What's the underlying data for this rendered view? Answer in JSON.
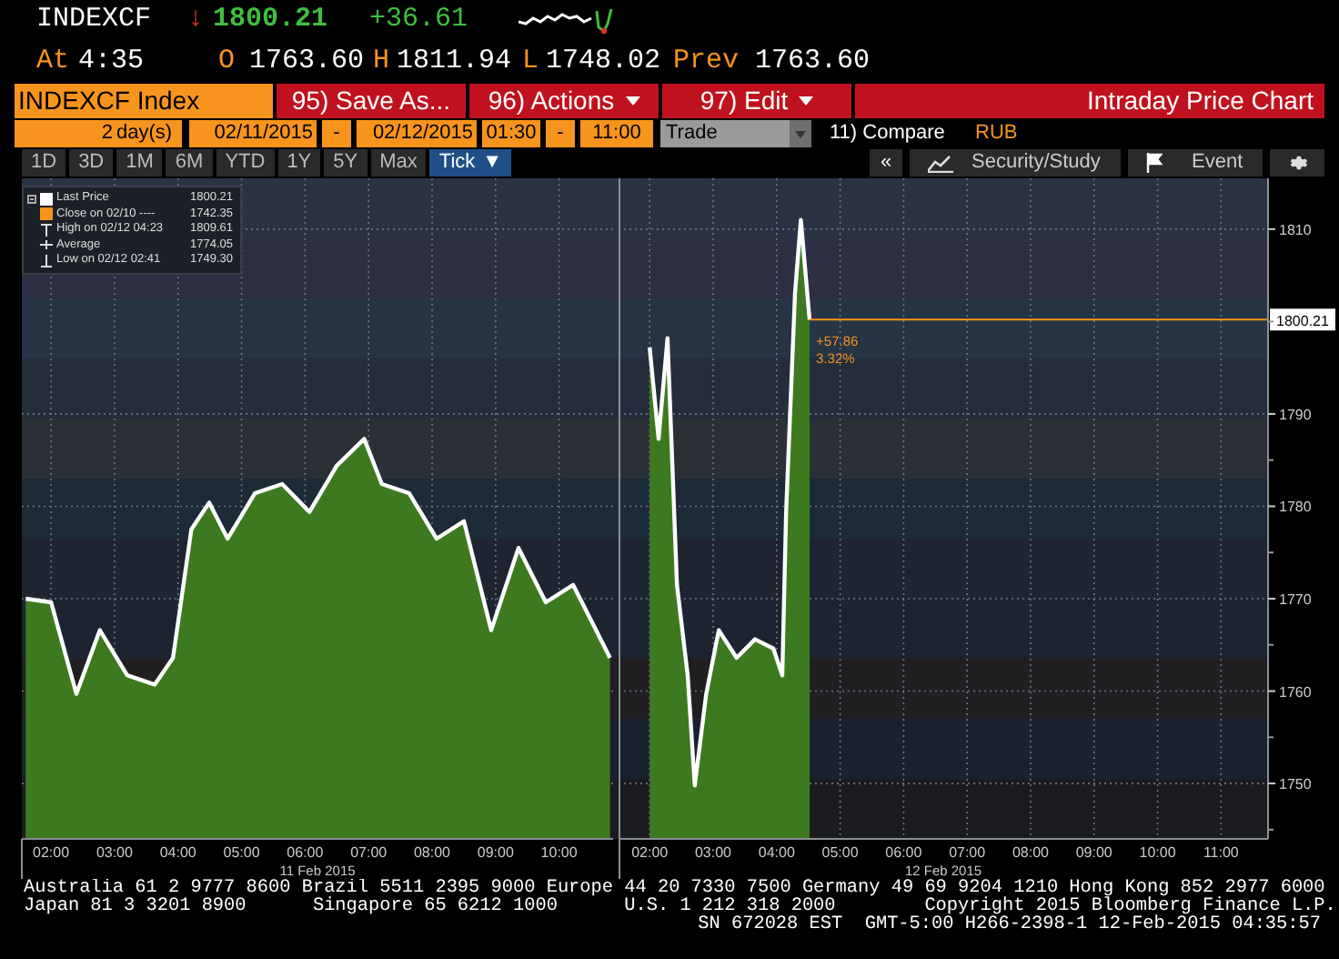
{
  "quote": {
    "ticker": "INDEXCF",
    "direction_arrow": "↓",
    "last": "1800.21",
    "change": "+36.61",
    "time_label": "At",
    "time": "4:35",
    "open_label": "O",
    "open": "1763.60",
    "high_label": "H",
    "high": "1811.94",
    "low_label": "L",
    "low": "1748.02",
    "prev_label": "Prev",
    "prev": "1763.60"
  },
  "toolbar": {
    "security": "INDEXCF Index",
    "buttons": [
      {
        "label": "95) Save As...",
        "dropdown": false
      },
      {
        "label": "96) Actions",
        "dropdown": true
      },
      {
        "label": "97) Edit",
        "dropdown": true
      }
    ],
    "title": "Intraday Price Chart"
  },
  "settings": {
    "days": "2",
    "days_unit": "day(s)",
    "start_date": "02/11/2015",
    "separator_1": "-",
    "end_date": "02/12/2015",
    "start_time": "01:30",
    "separator_2": "-",
    "end_time": "11:00",
    "mode": "Trade",
    "compare": "11) Compare",
    "currency": "RUB"
  },
  "ranges": [
    {
      "label": "1D",
      "selected": false
    },
    {
      "label": "3D",
      "selected": false
    },
    {
      "label": "1M",
      "selected": false
    },
    {
      "label": "6M",
      "selected": false
    },
    {
      "label": "YTD",
      "selected": false
    },
    {
      "label": "1Y",
      "selected": false
    },
    {
      "label": "5Y",
      "selected": false
    },
    {
      "label": "Max",
      "selected": false
    },
    {
      "label": "Tick",
      "selected": true,
      "caret": "▼"
    }
  ],
  "chart_tools": {
    "collapse": "«",
    "study": "Security/Study",
    "event": "Event"
  },
  "legend": [
    {
      "kind": "last",
      "label": "Last Price",
      "value": "1800.21",
      "color": "#ffffff"
    },
    {
      "kind": "close",
      "label": "Close on 02/10 ----",
      "value": "1742.35",
      "color": "#f7941d"
    },
    {
      "kind": "high",
      "label": "High on 02/12 04:23",
      "value": "1809.61"
    },
    {
      "kind": "average",
      "label": "Average",
      "value": "1774.05"
    },
    {
      "kind": "low",
      "label": "Low on 02/12 02:41",
      "value": "1749.30"
    }
  ],
  "chart": {
    "panels": [
      {
        "day_label": "11 Feb 2015",
        "chart_data": {
          "type": "area",
          "grid": true,
          "x": [
            1.6,
            2.0,
            2.4,
            2.77,
            3.2,
            3.63,
            3.92,
            4.21,
            4.49,
            4.78,
            5.21,
            5.64,
            6.07,
            6.5,
            6.93,
            7.21,
            7.64,
            8.07,
            8.5,
            8.93,
            9.36,
            9.79,
            10.22,
            10.51,
            10.8
          ],
          "series": [
            {
              "color": "#ffffff",
              "values": [
                1770,
                1769.6,
                1759.7,
                1766.6,
                1761.7,
                1760.7,
                1763.6,
                1777.5,
                1780.4,
                1776.5,
                1781.4,
                1782.4,
                1779.4,
                1784.4,
                1787.3,
                1782.4,
                1781.4,
                1776.5,
                1778.4,
                1766.6,
                1775.5,
                1769.6,
                1771.5,
                1767.6,
                1763.6
              ]
            }
          ],
          "xlim": [
            1.54,
            10.85
          ],
          "ylim": [
            1744,
            1815.5
          ],
          "xticks": [
            {
              "value": 2,
              "label": "02:00"
            },
            {
              "value": 3,
              "label": "03:00"
            },
            {
              "value": 4,
              "label": "04:00"
            },
            {
              "value": 5,
              "label": "05:00"
            },
            {
              "value": 6,
              "label": "06:00"
            },
            {
              "value": 7,
              "label": "07:00"
            },
            {
              "value": 8,
              "label": "08:00"
            },
            {
              "value": 9,
              "label": "09:00"
            },
            {
              "value": 10,
              "label": "10:00"
            }
          ]
        }
      },
      {
        "day_label": "12 Feb 2015",
        "chart_data": {
          "type": "area",
          "grid": true,
          "x": [
            2.0,
            2.14,
            2.28,
            2.43,
            2.6,
            2.71,
            2.89,
            3.09,
            3.37,
            3.66,
            3.95,
            4.09,
            4.15,
            4.29,
            4.38,
            4.52
          ],
          "series": [
            {
              "color": "#ffffff",
              "values": [
                1797.2,
                1787.3,
                1798.2,
                1771.5,
                1761.7,
                1749.8,
                1759.7,
                1766.6,
                1763.6,
                1765.6,
                1764.6,
                1761.7,
                1779.4,
                1803.1,
                1811,
                1800.2
              ]
            }
          ],
          "xlim": [
            1.51,
            11.74
          ],
          "ylim": [
            1744,
            1815.5
          ],
          "xticks": [
            {
              "value": 2,
              "label": "02:00"
            },
            {
              "value": 3,
              "label": "03:00"
            },
            {
              "value": 4,
              "label": "04:00"
            },
            {
              "value": 5,
              "label": "05:00"
            },
            {
              "value": 6,
              "label": "06:00"
            },
            {
              "value": 7,
              "label": "07:00"
            },
            {
              "value": 8,
              "label": "08:00"
            },
            {
              "value": 9,
              "label": "09:00"
            },
            {
              "value": 10,
              "label": "10:00"
            },
            {
              "value": 11,
              "label": "11:00"
            }
          ],
          "yticks": [
            1750,
            1760,
            1770,
            1780,
            1790,
            1810
          ],
          "ref_lines": [
            {
              "axis": "y",
              "value": 1800.21,
              "label": "1800.21",
              "color": "#f7941d"
            }
          ],
          "annotations": [
            {
              "text": "+57.86",
              "x": 4.62,
              "y": 1797.4
            },
            {
              "text": "3.32%",
              "x": 4.62,
              "y": 1795.5
            }
          ]
        }
      }
    ]
  },
  "footer": [
    "Australia 61 2 9777 8600 Brazil 5511 2395 9000 Europe 44 20 7330 7500 Germany 49 69 9204 1210 Hong Kong 852 2977 6000",
    "Japan 81 3 3201 8900      Singapore 65 6212 1000      U.S. 1 212 318 2000        Copyright 2015 Bloomberg Finance L.P.",
    "SN 672028 EST  GMT-5:00 H266-2398-1 12-Feb-2015 04:35:57"
  ]
}
